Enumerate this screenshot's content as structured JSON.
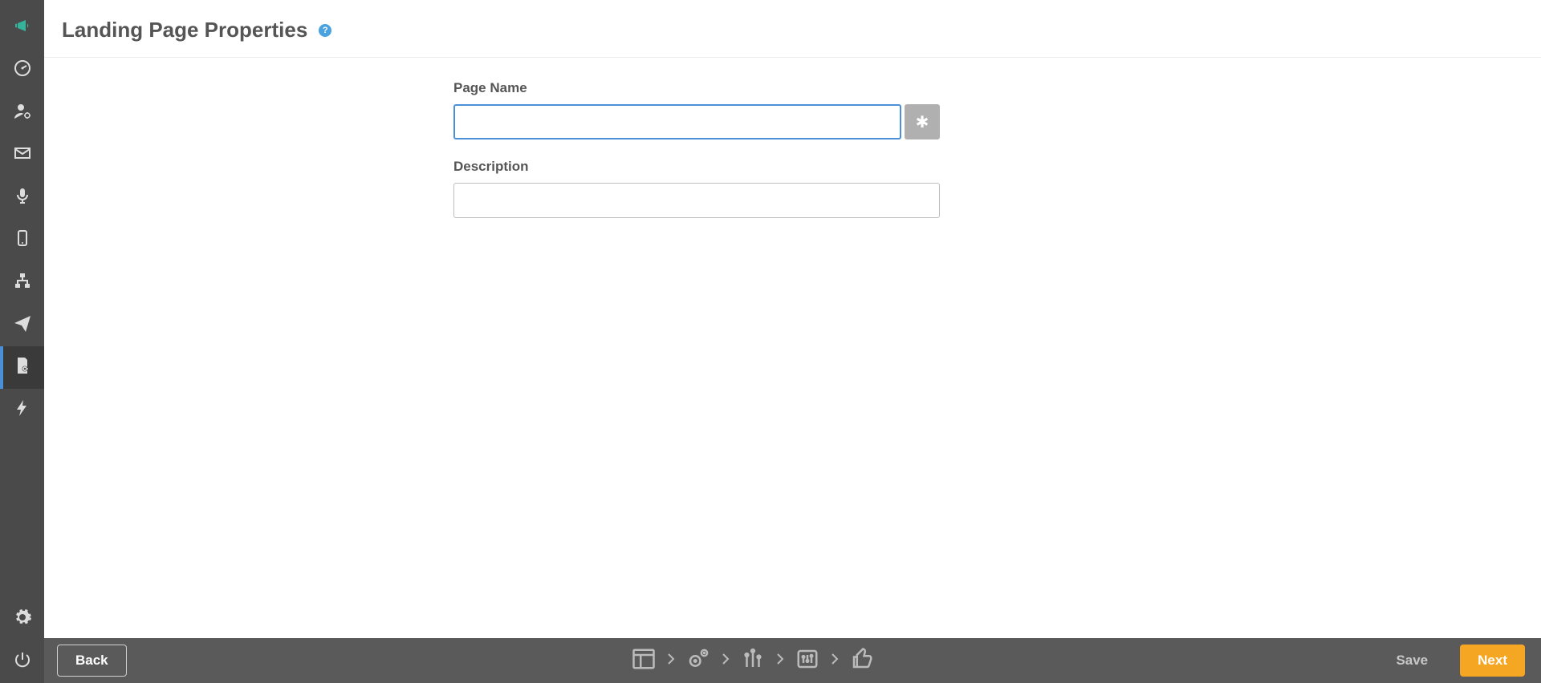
{
  "header": {
    "title": "Landing Page Properties",
    "help_glyph": "?"
  },
  "form": {
    "page_name": {
      "label": "Page Name",
      "value": "",
      "required_glyph": "✱"
    },
    "description": {
      "label": "Description",
      "value": ""
    }
  },
  "footer": {
    "back_label": "Back",
    "save_label": "Save",
    "next_label": "Next"
  },
  "sidebar_icons": [
    "megaphone-icon",
    "dashboard-icon",
    "user-settings-icon",
    "mail-icon",
    "microphone-icon",
    "mobile-icon",
    "sitemap-icon",
    "send-icon",
    "landing-page-icon",
    "bolt-icon",
    "gear-icon",
    "power-icon"
  ]
}
